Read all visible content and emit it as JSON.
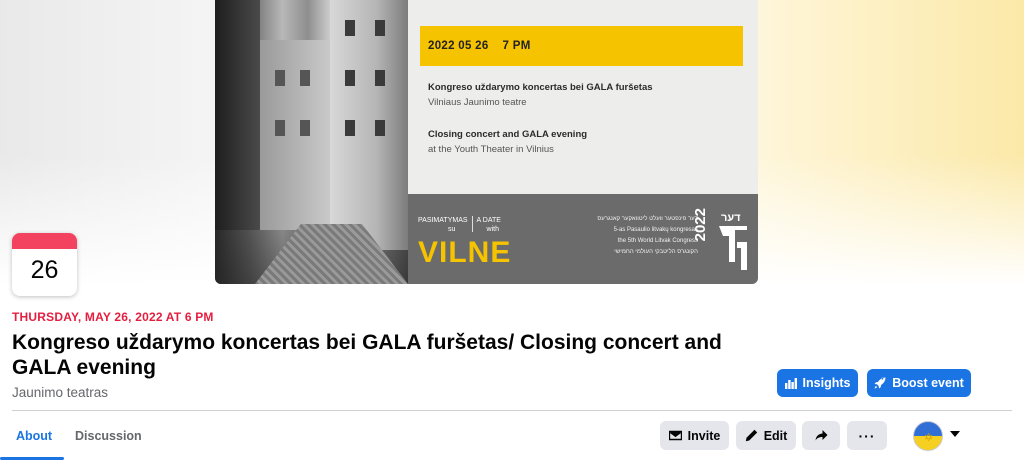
{
  "cover": {
    "poster_date": "2022 05 26    7 PM",
    "lt_title": "Kongreso uždarymo koncertas bei GALA furšetas",
    "lt_venue": "Vilniaus Jaunimo teatre",
    "en_title": "Closing concert and GALA evening",
    "en_venue": "at the Youth Theater in Vilnius",
    "ad_lt": "PASIMATYMAS",
    "ad_lt2": "su",
    "ad_en": "A DATE",
    "ad_en2": "with",
    "city": "VILNE",
    "congress_yi": "דער פינפטער וועלט ליטוואקער קאנגרעס",
    "congress_lt": "5-as Pasaulio litvakų kongresas",
    "congress_en": "the 5th World Litvak Congress",
    "congress_he": "הקונגרס הליטבקי העולמי החמישי",
    "logo_year": "2022",
    "logo_word": "דער"
  },
  "calendar": {
    "day": "26"
  },
  "event": {
    "date": "THURSDAY, MAY 26, 2022 AT 6 PM",
    "title": "Kongreso uždarymo koncertas bei GALA furšetas/ Closing concert and GALA evening",
    "venue": "Jaunimo teatras"
  },
  "actions": {
    "insights": "Insights",
    "boost": "Boost event",
    "invite": "Invite",
    "edit": "Edit",
    "more": "···"
  },
  "tabs": [
    {
      "label": "About",
      "active": true
    },
    {
      "label": "Discussion",
      "active": false
    }
  ],
  "colors": {
    "accent": "#1b74e4",
    "date_red": "#e41e3f",
    "calendar_red": "#f3425f",
    "poster_yellow": "#f5c300"
  }
}
